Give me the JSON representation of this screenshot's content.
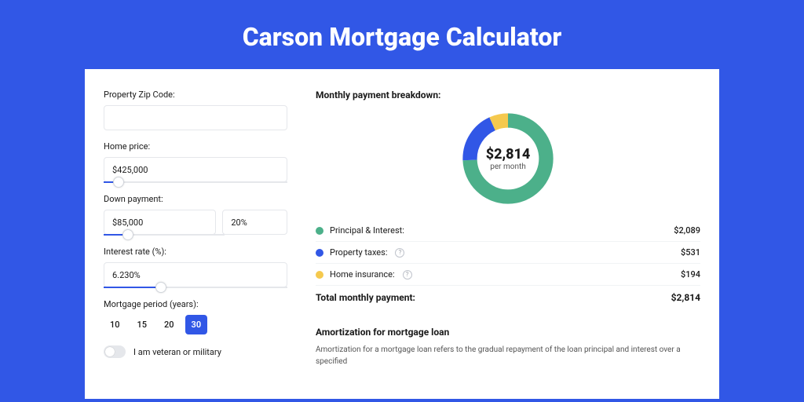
{
  "page": {
    "title": "Carson Mortgage Calculator"
  },
  "form": {
    "zip": {
      "label": "Property Zip Code:",
      "value": ""
    },
    "homePrice": {
      "label": "Home price:",
      "value": "$425,000",
      "slider_pct": 8
    },
    "downPayment": {
      "label": "Down payment:",
      "value": "$85,000",
      "pct": "20%",
      "slider_pct": 20
    },
    "interest": {
      "label": "Interest rate (%):",
      "value": "6.230%",
      "slider_pct": 31
    },
    "period": {
      "label": "Mortgage period (years):",
      "options": [
        "10",
        "15",
        "20",
        "30"
      ],
      "selected": "30"
    },
    "veteran": {
      "label": "I am veteran or military",
      "checked": false
    }
  },
  "breakdown": {
    "heading": "Monthly payment breakdown:",
    "center_amount": "$2,814",
    "center_sub": "per month",
    "colors": {
      "pi": "#4cb08a",
      "tax": "#3157e6",
      "ins": "#f5c94e"
    },
    "items": [
      {
        "key": "pi",
        "label": "Principal & Interest:",
        "amount": "$2,089",
        "info": false
      },
      {
        "key": "tax",
        "label": "Property taxes:",
        "amount": "$531",
        "info": true
      },
      {
        "key": "ins",
        "label": "Home insurance:",
        "amount": "$194",
        "info": true
      }
    ],
    "total_label": "Total monthly payment:",
    "total_amount": "$2,814"
  },
  "amort": {
    "heading": "Amortization for mortgage loan",
    "text": "Amortization for a mortgage loan refers to the gradual repayment of the loan principal and interest over a specified"
  },
  "chart_data": {
    "type": "pie",
    "title": "Monthly payment breakdown",
    "series": [
      {
        "name": "Principal & Interest",
        "value": 2089,
        "color": "#4cb08a"
      },
      {
        "name": "Property taxes",
        "value": 531,
        "color": "#3157e6"
      },
      {
        "name": "Home insurance",
        "value": 194,
        "color": "#f5c94e"
      }
    ],
    "total": 2814,
    "center_label": "$2,814 per month"
  }
}
